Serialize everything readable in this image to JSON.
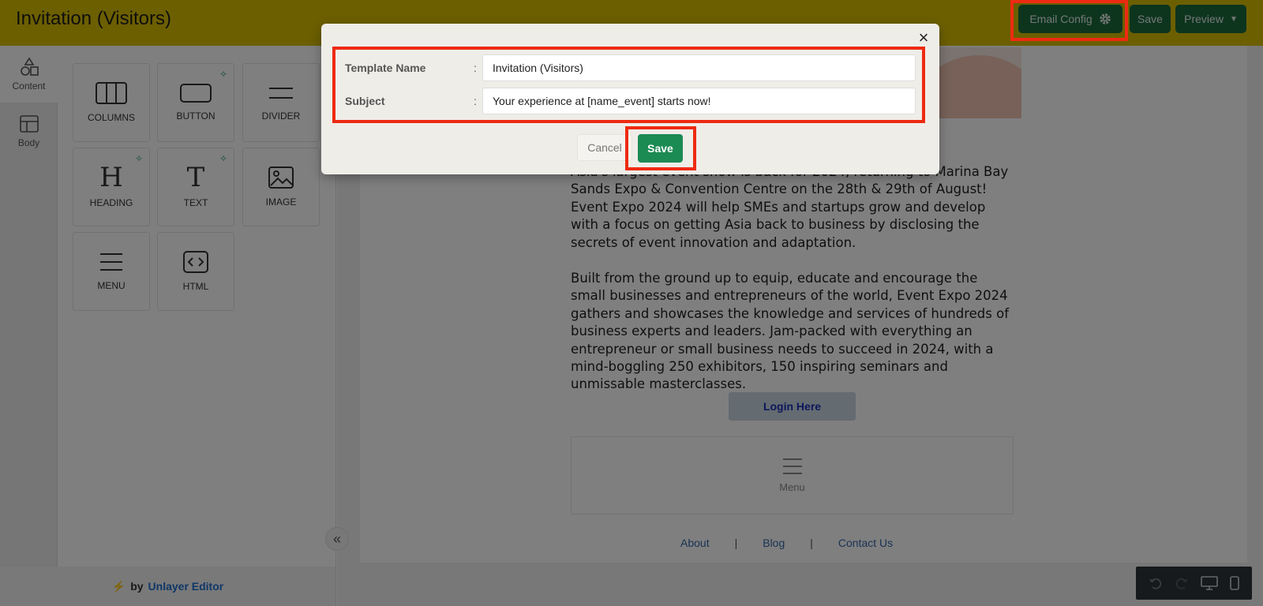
{
  "header": {
    "title": "Invitation (Visitors)",
    "email_config_label": "Email Config",
    "save_label": "Save",
    "preview_label": "Preview",
    "bg_color": "#d9be00",
    "button_color": "#1a6b3d"
  },
  "rail": {
    "tabs": [
      {
        "label": "Content",
        "icon": "shapes-icon",
        "active": true
      },
      {
        "label": "Body",
        "icon": "layout-icon",
        "active": false
      }
    ]
  },
  "tools": {
    "items": [
      {
        "label": "COLUMNS",
        "icon": "columns-icon",
        "ai": false
      },
      {
        "label": "BUTTON",
        "icon": "button-icon",
        "ai": true
      },
      {
        "label": "DIVIDER",
        "icon": "divider-icon",
        "ai": false
      },
      {
        "label": "HEADING",
        "icon": "heading-icon",
        "ai": true
      },
      {
        "label": "TEXT",
        "icon": "text-icon",
        "ai": true
      },
      {
        "label": "IMAGE",
        "icon": "image-icon",
        "ai": false
      },
      {
        "label": "MENU",
        "icon": "menu-icon",
        "ai": false
      },
      {
        "label": "HTML",
        "icon": "code-icon",
        "ai": false
      }
    ],
    "footer_by": "by",
    "footer_brand": "Unlayer Editor"
  },
  "email": {
    "para1": "Asia's largest event show is back for 2024, returning to Marina Bay Sands Expo & Convention Centre on the 28th & 29th of August! Event Expo 2024 will help SMEs and startups grow and develop with a focus on getting Asia back to business by disclosing the secrets of event innovation and adaptation.",
    "para2": "Built from the ground up to equip, educate and encourage the small businesses and entrepreneurs of the world, Event Expo 2024 gathers and showcases the knowledge and services of hundreds of business experts and leaders. Jam-packed with everything an entrepreneur or small business needs to succeed in 2024, with a mind-boggling 250 exhibitors, 150 inspiring seminars and unmissable masterclasses.",
    "login_label": "Login Here",
    "menu_placeholder": "Menu",
    "footer_links": [
      "About",
      "Blog",
      "Contact Us"
    ],
    "separator": "|"
  },
  "modal": {
    "template_name_label": "Template Name",
    "template_name_value": "Invitation (Visitors)",
    "subject_label": "Subject",
    "subject_value": "Your experience at [name_event] starts now!",
    "colon": ":",
    "cancel_label": "Cancel",
    "save_label": "Save",
    "close_glyph": "×"
  },
  "highlight_color": "#ee2a12"
}
